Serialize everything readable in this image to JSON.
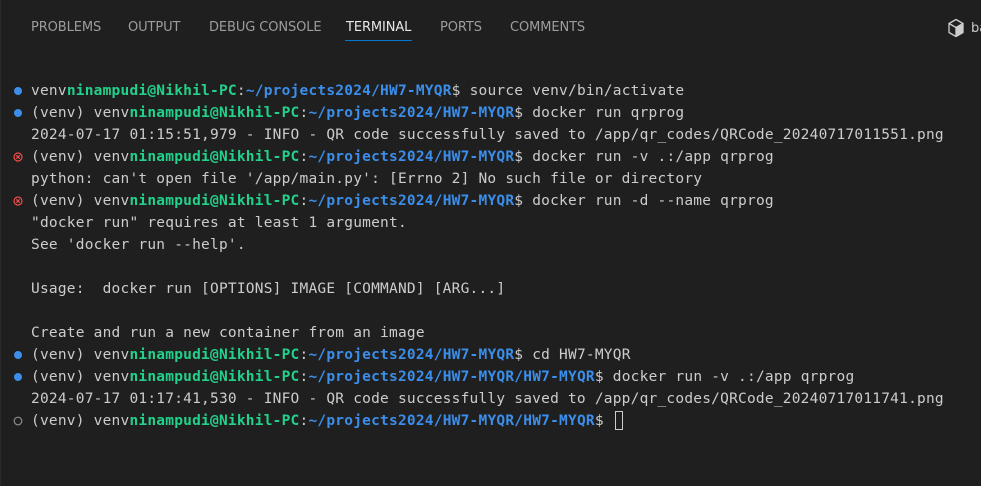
{
  "panel": {
    "tabs": [
      {
        "label": "PROBLEMS"
      },
      {
        "label": "OUTPUT"
      },
      {
        "label": "DEBUG CONSOLE"
      },
      {
        "label": "TERMINAL"
      },
      {
        "label": "PORTS"
      },
      {
        "label": "COMMENTS"
      }
    ],
    "active_tab": "TERMINAL",
    "shell_label": "ba",
    "shell_icon": "cube-icon"
  },
  "colors": {
    "background": "#1f1f1f",
    "text": "#cccccc",
    "user_host": "#23d18b",
    "path": "#3b8eea",
    "active_tab_underline": "#0078d4",
    "decoration_success": "#3b8eea",
    "decoration_error": "#f14c4c",
    "decoration_default": "#8b8b8b"
  },
  "terminal": {
    "lines": [
      {
        "decoration": "success",
        "env": "venv",
        "user": "ninampudi@Nikhil-PC",
        "sep": ":",
        "path": "~/projects2024/HW7-MYQR",
        "prompt": "$ ",
        "command": "source venv/bin/activate"
      },
      {
        "decoration": "success",
        "env": "(venv) venv",
        "user": "ninampudi@Nikhil-PC",
        "sep": ":",
        "path": "~/projects2024/HW7-MYQR",
        "prompt": "$ ",
        "command": "docker run qrprog"
      },
      {
        "decoration": "",
        "text": "2024-07-17 01:15:51,979 - INFO - QR code successfully saved to /app/qr_codes/QRCode_20240717011551.png"
      },
      {
        "decoration": "error",
        "env": "(venv) venv",
        "user": "ninampudi@Nikhil-PC",
        "sep": ":",
        "path": "~/projects2024/HW7-MYQR",
        "prompt": "$ ",
        "command": "docker run -v .:/app qrprog"
      },
      {
        "decoration": "",
        "text": "python: can't open file '/app/main.py': [Errno 2] No such file or directory"
      },
      {
        "decoration": "error",
        "env": "(venv) venv",
        "user": "ninampudi@Nikhil-PC",
        "sep": ":",
        "path": "~/projects2024/HW7-MYQR",
        "prompt": "$ ",
        "command": "docker run -d --name qrprog"
      },
      {
        "decoration": "",
        "text": "\"docker run\" requires at least 1 argument."
      },
      {
        "decoration": "",
        "text": "See 'docker run --help'."
      },
      {
        "decoration": "",
        "text": ""
      },
      {
        "decoration": "",
        "text": "Usage:  docker run [OPTIONS] IMAGE [COMMAND] [ARG...]"
      },
      {
        "decoration": "",
        "text": ""
      },
      {
        "decoration": "",
        "text": "Create and run a new container from an image"
      },
      {
        "decoration": "success",
        "env": "(venv) venv",
        "user": "ninampudi@Nikhil-PC",
        "sep": ":",
        "path": "~/projects2024/HW7-MYQR",
        "prompt": "$ ",
        "command": "cd HW7-MYQR"
      },
      {
        "decoration": "success",
        "env": "(venv) venv",
        "user": "ninampudi@Nikhil-PC",
        "sep": ":",
        "path": "~/projects2024/HW7-MYQR/HW7-MYQR",
        "prompt": "$ ",
        "command": "docker run -v .:/app qrprog"
      },
      {
        "decoration": "",
        "text": "2024-07-17 01:17:41,530 - INFO - QR code successfully saved to /app/qr_codes/QRCode_20240717011741.png"
      },
      {
        "decoration": "default",
        "env": "(venv) venv",
        "user": "ninampudi@Nikhil-PC",
        "sep": ":",
        "path": "~/projects2024/HW7-MYQR/HW7-MYQR",
        "prompt": "$ ",
        "command": "",
        "cursor": true
      }
    ]
  }
}
